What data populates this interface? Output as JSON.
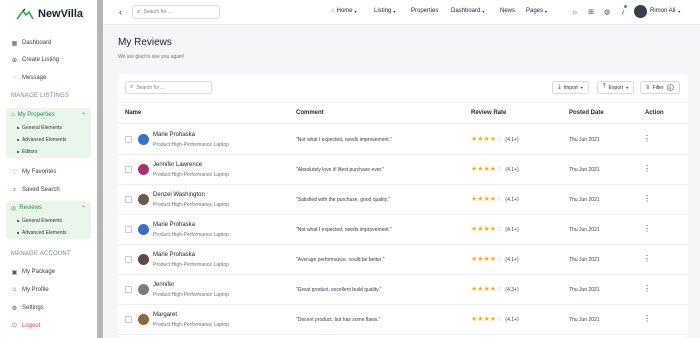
{
  "brand": {
    "name": "NewVilla"
  },
  "sidebar": {
    "items": [
      {
        "label": "Dashboard",
        "icon": "dashboard-icon",
        "glyph": "▦"
      },
      {
        "label": "Create Listing",
        "icon": "plus-circle-icon",
        "glyph": "⊕"
      },
      {
        "label": "Message",
        "icon": "message-icon",
        "glyph": "◌"
      }
    ],
    "section_listings": "MANAGE LISTINGS",
    "properties": {
      "label": "My Properties",
      "icon": "home-icon",
      "subitems": [
        "General Elements",
        "Advanced Elements",
        "Editors"
      ]
    },
    "listing_items": [
      {
        "label": "My Favorites",
        "icon": "heart-icon",
        "glyph": "♡"
      },
      {
        "label": "Saved Search",
        "icon": "search-icon",
        "glyph": "⌕"
      }
    ],
    "reviews": {
      "label": "Reviews",
      "icon": "review-icon",
      "subitems": [
        "General Elements",
        "Advanced Elements"
      ]
    },
    "section_account": "MANAGE ACCOUNT",
    "account_items": [
      {
        "label": "My Package",
        "icon": "package-icon",
        "glyph": "▣"
      },
      {
        "label": "My Profile",
        "icon": "user-icon",
        "glyph": "☺"
      },
      {
        "label": "Settings",
        "icon": "settings-icon",
        "glyph": "⚙"
      },
      {
        "label": "Logout",
        "icon": "logout-icon",
        "glyph": "⏻"
      }
    ]
  },
  "topbar": {
    "search_placeholder": "Search for ...",
    "menu": [
      {
        "label": "Home",
        "has_caret": true,
        "active_icon": true
      },
      {
        "label": "Listing",
        "has_caret": true
      },
      {
        "label": "Properties",
        "has_caret": false
      },
      {
        "label": "Dashboard",
        "has_caret": true
      },
      {
        "label": "News",
        "has_caret": false
      },
      {
        "label": "Pages",
        "has_caret": true
      }
    ],
    "user_name": "Rimon Ali"
  },
  "page": {
    "title": "My Reviews",
    "subtitle": "We are glad to see you again!"
  },
  "table": {
    "search_placeholder": "Search for ...",
    "import_label": "Import",
    "export_label": "Export",
    "filter_label": "Filter",
    "filter_count": "0",
    "columns": [
      "Name",
      "Comment",
      "Review Rate",
      "Posted Date",
      "Action"
    ],
    "rows": [
      {
        "name": "Marie Prohaska",
        "product": "Product:High-Performance Laptop",
        "comment": "\"Not what I expected, needs improvement.\"",
        "stars": 4,
        "rating": "(4.1+)",
        "date": "Thu Jun 2021",
        "avatar_color": "#3b6fc4"
      },
      {
        "name": "Jennifer Lawrence",
        "product": "Product:High-Performance Laptop",
        "comment": "\"Absolutely love it! Best purchase ever.\"",
        "stars": 4,
        "rating": "(4.1+)",
        "date": "Thu Jun 2021",
        "avatar_color": "#a8326e"
      },
      {
        "name": "Denzel Washington",
        "product": "Product:High-Performance Laptop",
        "comment": "\"Satisfied with the purchase, good quality.\"",
        "stars": 4,
        "rating": "(4.1+)",
        "date": "Thu Jun 2021",
        "avatar_color": "#6b5a4e"
      },
      {
        "name": "Marie Prohaska",
        "product": "Product:High-Performance Laptop",
        "comment": "\"Not what I expected, needs improvement.\"",
        "stars": 4,
        "rating": "(4.1+)",
        "date": "Thu Jun 2021",
        "avatar_color": "#3b6fc4"
      },
      {
        "name": "Marie Prohaska",
        "product": "Product:High-Performance Laptop",
        "comment": "\"Average performance, could be better.\"",
        "stars": 4,
        "rating": "(4.1+)",
        "date": "Thu Jun 2021",
        "avatar_color": "#5a4a44"
      },
      {
        "name": "Jennifer",
        "product": "Product:High-Performance Laptop",
        "comment": "\"Great product, excellent build quality.\"",
        "stars": 4,
        "rating": "(4.3+)",
        "date": "Thu Jun 2021",
        "avatar_color": "#7a7d85"
      },
      {
        "name": "Margaret",
        "product": "Product:High-Performance Laptop",
        "comment": "\"Decent product, but has some flaws.\"",
        "stars": 4,
        "rating": "(4.1+)",
        "date": "Thu Jun 2021",
        "avatar_color": "#8a6a3a"
      }
    ]
  },
  "colors": {
    "accent": "#2faa4f",
    "star": "#f2b01e",
    "danger": "#e34141"
  }
}
